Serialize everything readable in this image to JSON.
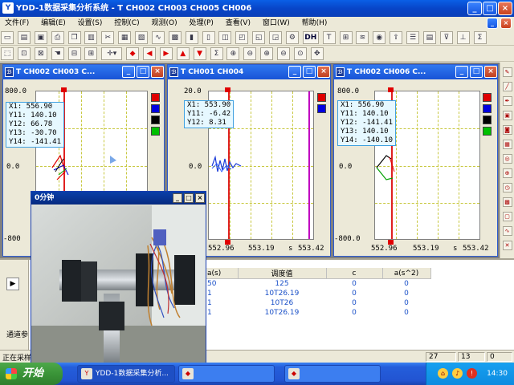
{
  "app": {
    "title": "YDD-1数据采集分析系统 -  T CH002 CH003 CH005 CH006",
    "icon": "app-logo-icon"
  },
  "menu": [
    "文件(F)",
    "编辑(E)",
    "设置(S)",
    "控制(C)",
    "观测(O)",
    "处理(P)",
    "查看(V)",
    "窗口(W)",
    "帮助(H)"
  ],
  "toolbar": {
    "dh_label": "DH"
  },
  "windows": [
    {
      "id": "win1",
      "title": "T CH002 CH003 C...",
      "y_top": "800.0",
      "y_mid": "0.0",
      "y_bot": "-800",
      "x_right": "",
      "readout": [
        "X1: 556.90",
        "Y11: 140.10",
        "Y12: 66.78",
        "Y13: -30.70",
        "Y14: -141.41"
      ],
      "swatches": [
        "#e00000",
        "#0000e0",
        "#000000",
        "#00c000"
      ]
    },
    {
      "id": "win2",
      "title": "T CH001 CH004",
      "y_top": "20.0",
      "y_mid": "0.0",
      "y_bot": "",
      "x_left": "552.96",
      "x_mid": "553.19",
      "x_unit": "s",
      "x_right": "553.42",
      "readout": [
        "X1: 553.90",
        "Y11: -6.42",
        "Y12: 8.31"
      ],
      "swatches": [
        "#e00000",
        "#0000e0"
      ]
    },
    {
      "id": "win3",
      "title": "T CH002 CH006 C...",
      "y_top": "800.0",
      "y_mid": "0.0",
      "y_bot": "-800.0",
      "x_left": "552.96",
      "x_mid": "553.19",
      "x_unit": "s",
      "x_right": "553.42",
      "readout": [
        "X1: 556.90",
        "Y11: 140.10",
        "Y12: -141.41",
        "Y13: 140.10",
        "Y14: -140.10"
      ],
      "swatches": [
        "#e00000",
        "#0000e0",
        "#000000",
        "#00c000"
      ]
    }
  ],
  "video": {
    "title": "0分钟"
  },
  "table": {
    "headers": [
      "a(s)",
      "调度值",
      "c",
      "a(s^2)"
    ],
    "rows": [
      [
        "50",
        "125",
        "0",
        "0"
      ],
      [
        "1",
        "10T26.19",
        "0",
        "0"
      ],
      [
        "1",
        "10T26",
        "0",
        "0"
      ],
      [
        "1",
        "10T26.19",
        "0",
        "0"
      ]
    ],
    "left_label": "通道参"
  },
  "status": {
    "left": "正在采样",
    "c1": "27",
    "c2": "13",
    "c3": "0"
  },
  "taskbar": {
    "start": "开始",
    "task1": "YDD-1数据采集分析...",
    "clock": "14:30"
  }
}
